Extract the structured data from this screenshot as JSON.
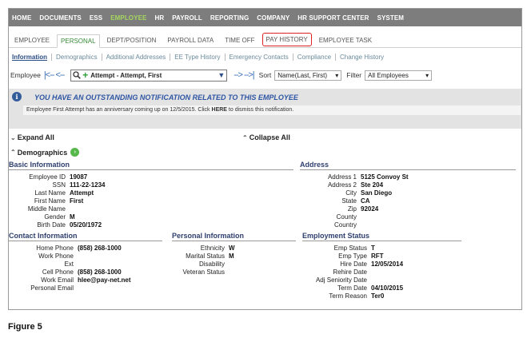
{
  "topnav": [
    "HOME",
    "DOCUMENTS",
    "ESS",
    "EMPLOYEE",
    "HR",
    "PAYROLL",
    "REPORTING",
    "COMPANY",
    "HR SUPPORT CENTER",
    "SYSTEM"
  ],
  "tabs": [
    "EMPLOYEE",
    "PERSONAL",
    "DEPT/POSITION",
    "PAYROLL DATA",
    "TIME OFF",
    "PAY HISTORY",
    "EMPLOYEE TASK"
  ],
  "sublinks": [
    "Information",
    "Demographics",
    "Additional Addresses",
    "EE Type History",
    "Emergency Contacts",
    "Compliance",
    "Change History"
  ],
  "employee": {
    "label": "Employee",
    "nav_back": "|<-- <--",
    "value": "Attempt - Attempt, First",
    "nav_fwd": "--> -->|",
    "sort_label": "Sort",
    "sort_value": "Name(Last, First)",
    "filter_label": "Filter",
    "filter_value": "All Employees"
  },
  "notification": {
    "title": "YOU HAVE AN OUTSTANDING NOTIFICATION RELATED TO THIS EMPLOYEE",
    "msg_pre": "Employee First Attempt has an anniversary coming up on 12/5/2015. Click ",
    "msg_link": "HERE",
    "msg_post": " to dismiss this notification."
  },
  "expand_all": "Expand All",
  "collapse_all": "Collapse All",
  "demographics": "Demographics",
  "sections": {
    "basic": "Basic Information",
    "address": "Address",
    "contact": "Contact Information",
    "personal": "Personal Information",
    "employment": "Employment Status"
  },
  "basic_fields": [
    {
      "k": "Employee ID",
      "v": "19087"
    },
    {
      "k": "SSN",
      "v": "111-22-1234"
    },
    {
      "k": "Last Name",
      "v": "Attempt"
    },
    {
      "k": "First Name",
      "v": "First"
    },
    {
      "k": "Middle Name",
      "v": ""
    },
    {
      "k": "Gender",
      "v": "M"
    },
    {
      "k": "Birth Date",
      "v": "05/20/1972"
    }
  ],
  "address_fields": [
    {
      "k": "Address 1",
      "v": "5125 Convoy St"
    },
    {
      "k": "Address 2",
      "v": "Ste 204"
    },
    {
      "k": "City",
      "v": "San Diego"
    },
    {
      "k": "State",
      "v": "CA"
    },
    {
      "k": "Zip",
      "v": "92024"
    },
    {
      "k": "County",
      "v": ""
    },
    {
      "k": "Country",
      "v": ""
    }
  ],
  "contact_fields": [
    {
      "k": "Home Phone",
      "v": "(858) 268-1000"
    },
    {
      "k": "Work Phone",
      "v": ""
    },
    {
      "k": "Ext",
      "v": ""
    },
    {
      "k": "Cell Phone",
      "v": "(858) 268-1000"
    },
    {
      "k": "Work Email",
      "v": "hlee@pay-net.net"
    },
    {
      "k": "Personal Email",
      "v": ""
    }
  ],
  "personal_fields": [
    {
      "k": "Ethnicity",
      "v": "W"
    },
    {
      "k": "Marital Status",
      "v": "M"
    },
    {
      "k": "Disability",
      "v": ""
    },
    {
      "k": "Veteran Status",
      "v": ""
    }
  ],
  "employment_fields": [
    {
      "k": "Emp Status",
      "v": "T"
    },
    {
      "k": "Emp Type",
      "v": "RFT"
    },
    {
      "k": "Hire Date",
      "v": "12/05/2014"
    },
    {
      "k": "Rehire Date",
      "v": ""
    },
    {
      "k": "Adj Seniority Date",
      "v": ""
    },
    {
      "k": "Term Date",
      "v": "04/10/2015"
    },
    {
      "k": "Term Reason",
      "v": "Ter0"
    }
  ],
  "caption": "Figure 5"
}
